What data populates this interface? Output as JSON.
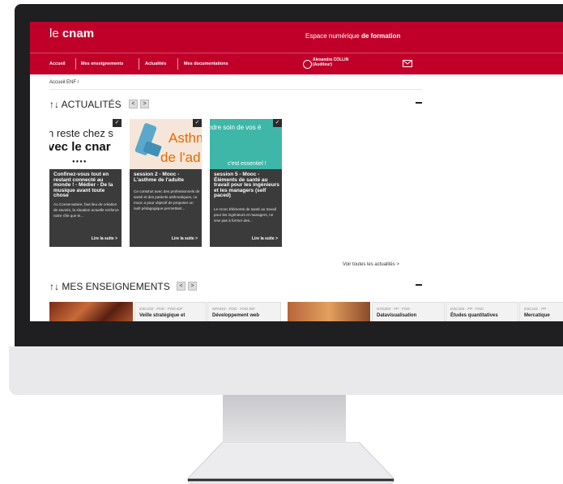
{
  "brand": {
    "logo_prefix": "le ",
    "logo_bold": "cnam",
    "space_prefix": "Espace numérique ",
    "space_bold": "de formation",
    "accent_color": "#c1002a"
  },
  "nav": {
    "items": [
      "Accueil",
      "Mes enseignements",
      "Actualités",
      "Mes documentations"
    ],
    "user_name": "Alexandra COLLIN",
    "user_role": "(Auditeur)",
    "user_icon": "user-icon",
    "mail_icon": "mail-icon"
  },
  "breadcrumb": "Accueil ENF /",
  "news": {
    "title": "ACTUALITÉS",
    "sort_icon": "↑↓",
    "prev": "<",
    "next": ">",
    "view_all": "Voir toutes les actualités >",
    "cards": [
      {
        "image_line1": "n reste chez s",
        "image_line2": "vec le cnar",
        "title": "Confinez-vous tout en restant connecté au monde ! - Médier - De la musique avant toute chose",
        "desc": "Au Conservatoire, faut lieu de création de savoirs, la situation actuelle renforce notre rôle que le...",
        "more": "Lire la suite >"
      },
      {
        "image_line1": "Asthm",
        "image_line2": "de l'ad",
        "title": "session 2 - Mooc - L'asthme de l'adulte",
        "desc": "Ce construit avec des professionnels de santé et des patients asthmatiques, ce mooc a pour objectif de proposer un outil pédagogique permettant...",
        "more": "Lire la suite >"
      },
      {
        "image_line1": "ndre soin de vos é",
        "image_line2": "c'est essentiel !",
        "title": "session 5 - Mooc - Éléments de santé au travail pour les ingénieurs et les managers (self paced)",
        "desc": "Le mooc Éléments de santé au travail pour les ingénieurs et managers, ne vise pas à former des...",
        "more": "Lire la suite >"
      }
    ]
  },
  "courses": {
    "title": "MES ENSEIGNEMENTS",
    "sort_icon": "↑↓",
    "prev": "<",
    "next": ">",
    "items": [
      {
        "code": "ESC103 - FOD - FOD IDF",
        "title": "Veille stratégique et"
      },
      {
        "code": "NFA016 - FOD - FOD IDF",
        "title": "Développement web"
      },
      {
        "code": "NTD204 - FP - FOD",
        "title": "Datavisualisation"
      },
      {
        "code": "ESC104 - FP - FOD",
        "title": "Études quantitatives"
      },
      {
        "code": "ESC101 - FP",
        "title": "Mercatique"
      }
    ]
  }
}
